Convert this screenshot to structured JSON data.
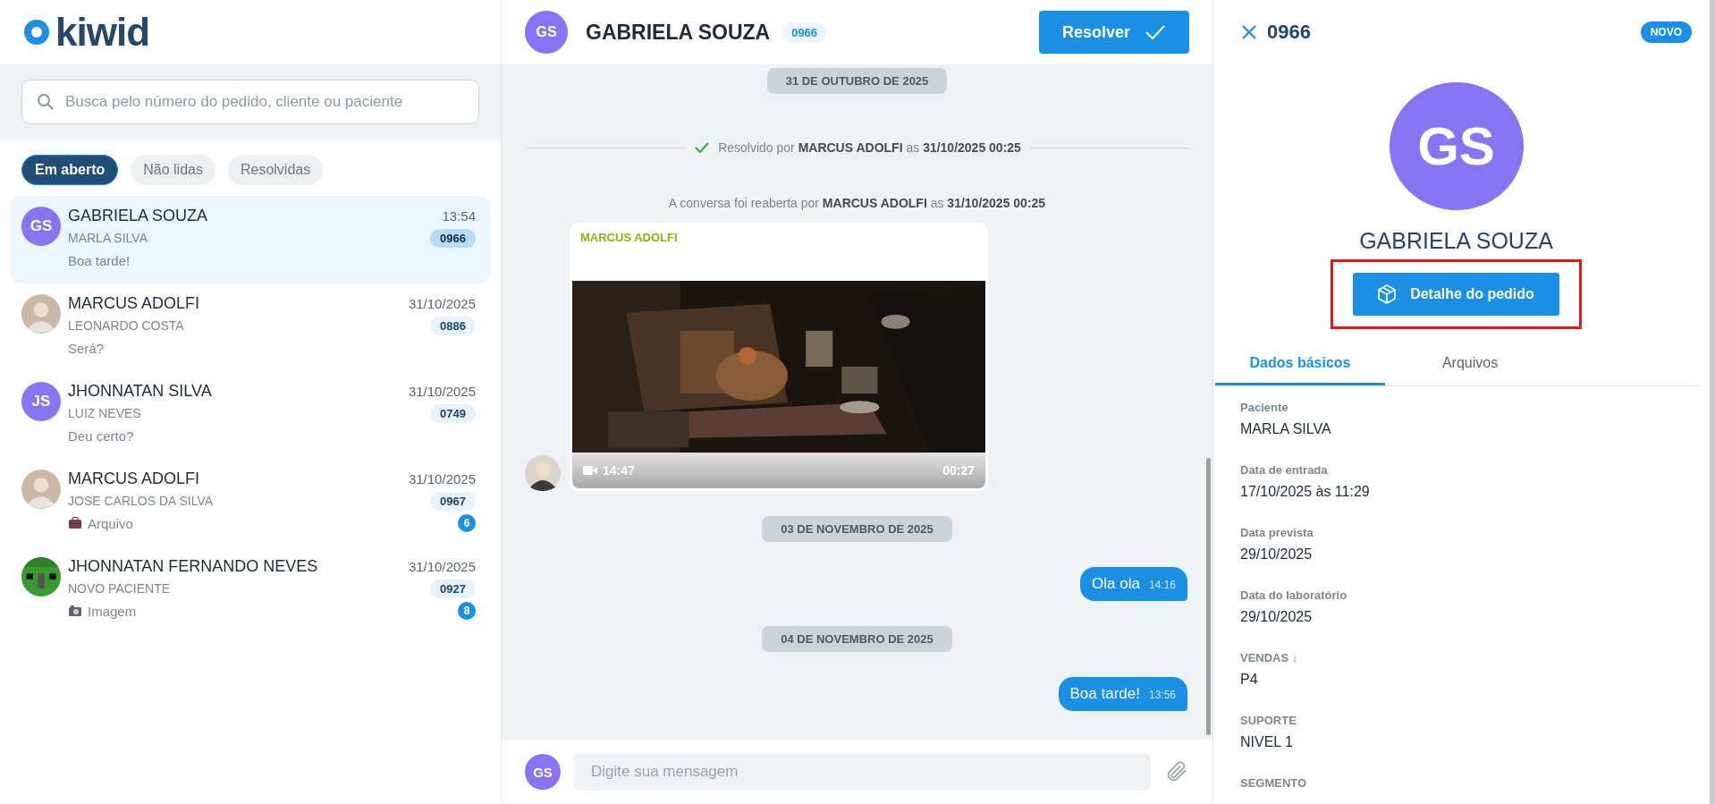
{
  "logo": {
    "text": "kiwid"
  },
  "search": {
    "placeholder": "Busca pelo número do pedido, cliente ou paciente"
  },
  "filters": [
    {
      "label": "Em aberto",
      "selected": true
    },
    {
      "label": "Não lidas",
      "selected": false
    },
    {
      "label": "Resolvidas",
      "selected": false
    }
  ],
  "conversations": [
    {
      "avatar": {
        "kind": "initials",
        "initials": "GS"
      },
      "name": "GABRIELA SOUZA",
      "time": "13:54",
      "patient": "MARLA SILVA",
      "order": "0966",
      "kind": "text",
      "preview": "Boa tarde!",
      "selected": true
    },
    {
      "name": "MARCUS ADOLFI",
      "time": "31/10/2025",
      "patient": "LEONARDO COSTA",
      "order": "0886",
      "kind": "text",
      "preview": "Será?",
      "selected": false
    },
    {
      "avatar": {
        "kind": "initials",
        "initials": "JS"
      },
      "name": "JHONNATAN SILVA",
      "time": "31/10/2025",
      "patient": "LUIZ NEVES",
      "order": "0749",
      "kind": "text",
      "preview": "Deu certo?",
      "selected": false
    },
    {
      "name": "MARCUS ADOLFI",
      "time": "31/10/2025",
      "patient": "JOSE CARLOS DA SILVA",
      "order": "0967",
      "kind": "file",
      "preview": "Arquivo",
      "unread": "6",
      "selected": false
    },
    {
      "avatar": {
        "kind": "block"
      },
      "name": "JHONNATAN FERNANDO NEVES",
      "time": "31/10/2025",
      "patient": "NOVO PACIENTE",
      "order": "0927",
      "preview": "Imagem",
      "unread": "8",
      "selected": false
    }
  ],
  "chat": {
    "avatar": "GS",
    "name": "GABRIELA SOUZA",
    "order": "0966",
    "resolve_button": "Resolver",
    "messages": [
      {
        "kind": "date",
        "text": "31 DE OUTUBRO DE 2025"
      },
      {
        "kind": "resolved",
        "text": "Resolvido por **MARCUS ADOLFI** as **31/10/2025 00:25**"
      },
      {
        "kind": "reopened",
        "text": "A conversa foi reaberta por **MARCUS ADOLFI** as **31/10/2025 00:25**"
      },
      {
        "kind": "video",
        "sender": "MARCUS ADOLFI",
        "time": "14:47",
        "duration": "00:27"
      },
      {
        "kind": "date",
        "text": "03 DE NOVEMBRO DE 2025"
      },
      {
        "kind": "outgoing",
        "text": "Ola ola",
        "time": "14:16"
      },
      {
        "kind": "date",
        "text": "04 DE NOVEMBRO DE 2025"
      },
      {
        "kind": "outgoing",
        "text": "Boa tarde!",
        "time": "13:56"
      }
    ],
    "composer": {
      "avatar": "GS",
      "placeholder": "Digite sua mensagem"
    }
  },
  "details": {
    "order": "0966",
    "badge": "NOVO",
    "avatar": "GS",
    "name": "GABRIELA SOUZA",
    "detail_button": {
      "label": "Detalhe do pedido",
      "highlighted": true
    },
    "tabs": [
      {
        "label": "Dados básicos",
        "selected": true
      },
      {
        "label": "Arquivos",
        "selected": false
      }
    ],
    "fields": [
      {
        "label": "Paciente",
        "value": "MARLA SILVA"
      },
      {
        "label": "Data de entrada",
        "value": "17/10/2025 às 11:29"
      },
      {
        "label": "Data prevista",
        "value": "29/10/2025"
      },
      {
        "label": "Data do laboratório",
        "value": "29/10/2025"
      },
      {
        "label": "VENDAS ↓",
        "value": "P4"
      },
      {
        "label": "SUPORTE",
        "value": "NIVEL 1"
      },
      {
        "label": "SEGMENTO"
      }
    ]
  }
}
